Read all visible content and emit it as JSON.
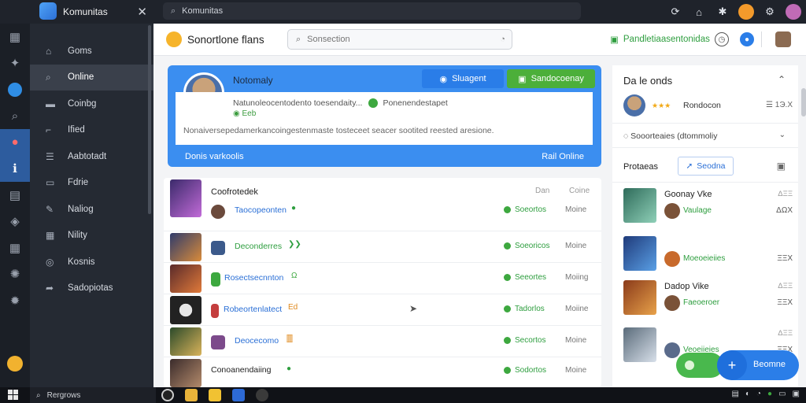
{
  "window": {
    "title": "Komunitas",
    "search_value": "Komunitas",
    "close_glyph": "✕"
  },
  "sidebar": {
    "items": [
      {
        "label": "Goms",
        "icon": "home-icon"
      },
      {
        "label": "Online",
        "icon": "search-icon"
      },
      {
        "label": "Coinbg",
        "icon": "chat-icon"
      },
      {
        "label": "Ified",
        "icon": "feed-icon"
      },
      {
        "label": "Aabtotadt",
        "icon": "list-icon"
      },
      {
        "label": "Fdrie",
        "icon": "clipboard-icon"
      },
      {
        "label": "Naliog",
        "icon": "pen-icon"
      },
      {
        "label": "Nility",
        "icon": "grid-icon"
      },
      {
        "label": "Kosnis",
        "icon": "globe-icon"
      },
      {
        "label": "Sadopiotas",
        "icon": "share-icon"
      }
    ]
  },
  "header": {
    "brand": "Sonortlone flans",
    "search_placeholder": "Sonsection",
    "green_link": "Pandletiaasentonidas"
  },
  "profile": {
    "name": "Notomaly",
    "btn_primary": "Sluagent",
    "btn_secondary": "Sandocoenay",
    "meta": "Natunoleocentodento toesendaity...",
    "meta_status": "Ponenendestapet",
    "meta_sub": "Eeb",
    "bio": "Nonaiversepedamerkancoingestenmaste tosteceet seacer sootited reested aresione.",
    "footer_left": "Donis varkoolis",
    "footer_right": "Rail Online"
  },
  "games": {
    "title": "Coofrotedek",
    "col1": "Dan",
    "col2": "Coine",
    "rows": [
      {
        "label": "Taocopeonten",
        "label_color": "#2a6fd6",
        "tag": "●",
        "status": "Soeortos",
        "mode": "Moine"
      },
      {
        "label": "Deconderres",
        "label_color": "#2e9e3f",
        "tag": "❯❯",
        "status": "Soeoricos",
        "mode": "Moine"
      },
      {
        "label": "Rosectsecnnton",
        "label_color": "#2a6fd6",
        "tag": "Ω",
        "status": "Seeortes",
        "mode": "Moiing"
      },
      {
        "label": "Robeortenlatect",
        "label_color": "#2a6fd6",
        "tag": "Ed",
        "status": "Tadorlos",
        "mode": "Moiine"
      },
      {
        "label": "Deocecomo",
        "label_color": "#2a6fd6",
        "tag": "🀫",
        "status": "Secortos",
        "mode": "Moine"
      },
      {
        "label": "Conoanendaiing",
        "label_color": "#222",
        "tag": "●",
        "status": "Sodortos",
        "mode": "Moine"
      }
    ]
  },
  "right_panel": {
    "title": "Da le onds",
    "user_name": "Rondocon",
    "user_score": "☰ 1Э.Х",
    "note": "Sooorteaies (dtommoliy",
    "friends_label": "Protaeas",
    "friends_btn": "Seodna",
    "items": [
      {
        "title": "Goonay Vke",
        "sub": "Vaulage",
        "num": "ΔΞΞ",
        "num2": "ΔΩХ"
      },
      {
        "title": "",
        "sub": "Moeoeieiies",
        "num": "",
        "num2": "ΞΞХ"
      },
      {
        "title": "Dadop Vike",
        "sub": "Faeoeroer",
        "num": "ΔΞΞ",
        "num2": "ΞΞХ"
      },
      {
        "title": "",
        "sub": "Veoeiieies",
        "num": "ΔΞΞ",
        "num2": "ΞΞХ"
      }
    ]
  },
  "fab": {
    "label": "Beomne"
  },
  "taskbar": {
    "search_value": "Rergrows"
  },
  "colors": {
    "accent_blue": "#3b8ef0",
    "accent_green": "#4caf3a",
    "sidebar_bg": "#252a33"
  }
}
